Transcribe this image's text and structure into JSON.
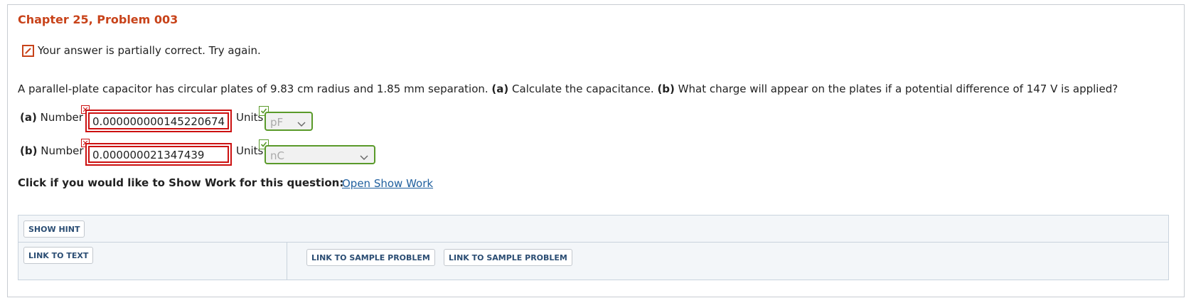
{
  "problem": {
    "title": "Chapter 25, Problem 003",
    "status_text": "Your answer is partially correct.  Try again.",
    "question": {
      "intro": "A parallel-plate capacitor has circular plates of 9.83 cm radius and 1.85 mm separation.",
      "part_a_tag": "(a)",
      "part_a_text": "Calculate the capacitance.",
      "part_b_tag": "(b)",
      "part_b_text": "What charge will appear on the plates if a potential difference of 147 V is applied?"
    }
  },
  "answers": [
    {
      "tag": "(a)",
      "label": "Number",
      "value": "0.000000000145220674",
      "number_status": "incorrect",
      "units_label": "Units",
      "unit": "pF",
      "unit_status": "correct"
    },
    {
      "tag": "(b)",
      "label": "Number",
      "value": "0.000000021347439",
      "number_status": "incorrect",
      "units_label": "Units",
      "unit": "nC",
      "unit_status": "correct"
    }
  ],
  "show_work": {
    "prompt": "Click if you would like to Show Work for this question:",
    "link": "Open Show Work"
  },
  "resources": {
    "hint_button": "SHOW HINT",
    "text_button": "LINK TO TEXT",
    "sample_buttons": [
      "LINK TO SAMPLE PROBLEM",
      "LINK TO SAMPLE PROBLEM"
    ]
  },
  "colors": {
    "title": "#c8431a",
    "incorrect": "#cc1111",
    "correct": "#5a9a2a",
    "link": "#1f5f9e",
    "button_text": "#2b4d73"
  },
  "icons": [
    "pencil-icon",
    "incorrect-mark-icon",
    "correct-mark-icon",
    "chevron-down-icon"
  ]
}
